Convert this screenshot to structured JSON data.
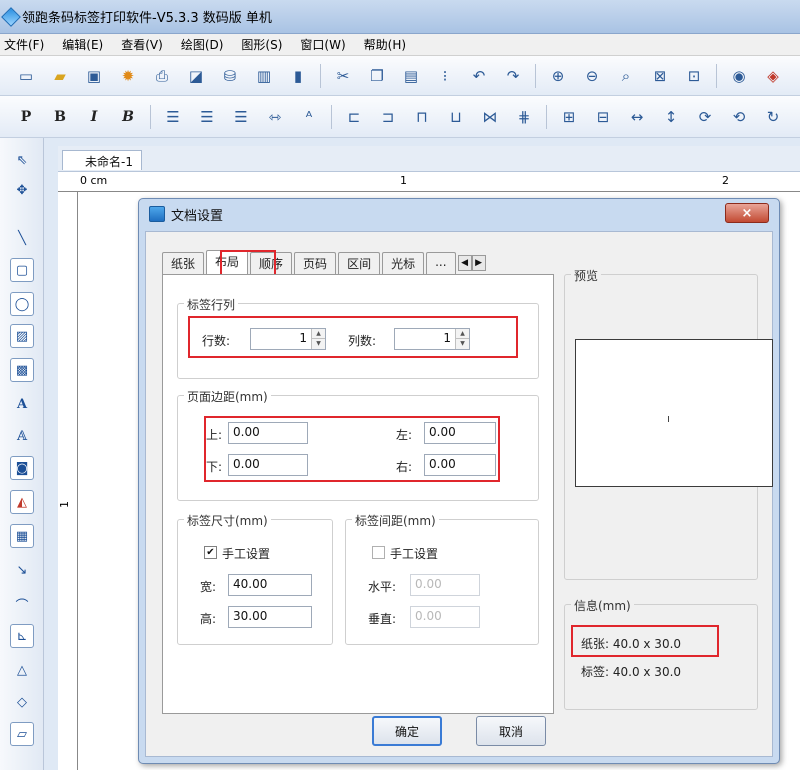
{
  "app": {
    "title": "领跑条码标签打印软件-V5.3.3 数码版 单机"
  },
  "menu": [
    "文件(F)",
    "编辑(E)",
    "查看(V)",
    "绘图(D)",
    "图形(S)",
    "窗口(W)",
    "帮助(H)"
  ],
  "toolbar2": {
    "bold_p": "P",
    "bold_b": "B",
    "italic_i": "I",
    "bold_italic_b": "B"
  },
  "document": {
    "tab_label": "未命名-1",
    "ruler_h": [
      "0 cm",
      "1",
      "2"
    ],
    "ruler_v": [
      "1"
    ]
  },
  "dialog": {
    "title": "文档设置",
    "close_label": "×",
    "tabs": [
      "纸张",
      "布局",
      "顺序",
      "页码",
      "区间",
      "光标",
      "..."
    ],
    "active_tab": "布局",
    "label_rowcol": {
      "legend": "标签行列",
      "rows_label": "行数:",
      "rows_value": "1",
      "cols_label": "列数:",
      "cols_value": "1"
    },
    "margins": {
      "legend": "页面边距(mm)",
      "top_label": "上:",
      "top_value": "0.00",
      "left_label": "左:",
      "left_value": "0.00",
      "bottom_label": "下:",
      "bottom_value": "0.00",
      "right_label": "右:",
      "right_value": "0.00"
    },
    "label_size": {
      "legend": "标签尺寸(mm)",
      "manual_label": "手工设置",
      "manual_checked": true,
      "width_label": "宽:",
      "width_value": "40.00",
      "height_label": "高:",
      "height_value": "30.00"
    },
    "label_gap": {
      "legend": "标签间距(mm)",
      "manual_label": "手工设置",
      "manual_checked": false,
      "h_label": "水平:",
      "h_value": "0.00",
      "v_label": "垂直:",
      "v_value": "0.00"
    },
    "preview": {
      "legend": "预览"
    },
    "info": {
      "legend": "信息(mm)",
      "paper": "纸张: 40.0 x 30.0",
      "label": "标签: 40.0 x 30.0"
    },
    "ok_label": "确定",
    "cancel_label": "取消"
  },
  "colors": {
    "highlight": "#e0262c",
    "titlebar": "#b9cfe9"
  }
}
